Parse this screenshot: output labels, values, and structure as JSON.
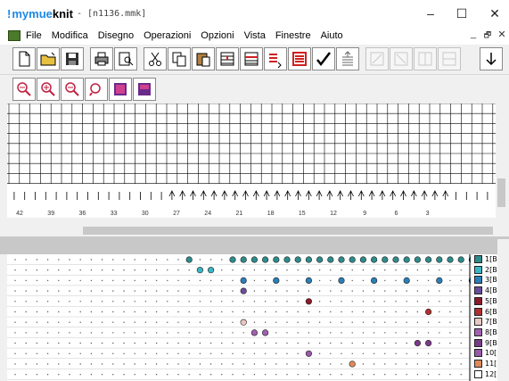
{
  "app": {
    "logo_bang": "!",
    "logo_brand": "mymue",
    "logo_bold": "knit",
    "file_title": "- [n1136.mmk]",
    "controls": {
      "minimize": "–",
      "maximize": "☐",
      "close": "✕"
    },
    "mdi_controls": {
      "minimize": "_",
      "restore": "🗗",
      "close": "✕"
    }
  },
  "menu": [
    {
      "key": "F",
      "rest": "ile"
    },
    {
      "key": "M",
      "rest": "odifica"
    },
    {
      "key": "D",
      "rest": "isegno"
    },
    {
      "key": "O",
      "rest": "perazioni"
    },
    {
      "key": "O",
      "rest": "pzioni",
      "pre": "",
      "raw": "Opzioni"
    },
    {
      "key": "V",
      "rest": "ista"
    },
    {
      "key": "F",
      "rest": "inestre"
    },
    {
      "key": "A",
      "rest": "iuto"
    }
  ],
  "menu_labels": [
    "File",
    "Modifica",
    "Disegno",
    "Operazioni",
    "Opzioni",
    "Vista",
    "Finestre",
    "Aiuto"
  ],
  "toolbar1": [
    "new-file-icon",
    "open-folder-icon",
    "save-disk-icon",
    "print-icon",
    "print-preview-icon",
    "cut-icon",
    "copy-icon",
    "paste-icon",
    "insert-rows-icon",
    "insert-cols-icon",
    "row-tool-icon",
    "row-color-icon",
    "check-icon",
    "stack-icon",
    "tool-a-icon",
    "tool-b-icon",
    "tool-c-icon",
    "tool-d-icon",
    "arrow-down-icon"
  ],
  "toolbar2": [
    "zoom-fit-icon",
    "zoom-in-icon",
    "zoom-out-icon",
    "zoom-reset-icon",
    "color-block-1-icon",
    "color-block-2-icon"
  ],
  "ruler_labels": [
    "42",
    "39",
    "36",
    "33",
    "30",
    "27",
    "24",
    "21",
    "18",
    "15",
    "12",
    "9",
    "6",
    "3"
  ],
  "swatches": [
    {
      "label": "1[B",
      "color": "#2e8b8b"
    },
    {
      "label": "2[B",
      "color": "#39b6c4"
    },
    {
      "label": "3[B",
      "color": "#2a7fb8"
    },
    {
      "label": "4[B",
      "color": "#6a4c9c"
    },
    {
      "label": "5[B",
      "color": "#8b1a2a"
    },
    {
      "label": "6[B",
      "color": "#b03030"
    },
    {
      "label": "7[B",
      "color": "#e8c8c0"
    },
    {
      "label": "8[B",
      "color": "#a060b0"
    },
    {
      "label": "9[B",
      "color": "#7a3a8a"
    },
    {
      "label": "10[",
      "color": "#9a58a8"
    },
    {
      "label": "11[",
      "color": "#e08a5a"
    },
    {
      "label": "12[",
      "color": "#ffffff"
    }
  ],
  "pattern_rows": [
    {
      "color": "#2e8b8b",
      "cols": [
        29,
        25,
        24,
        23,
        22,
        21,
        20,
        19,
        18,
        17,
        16,
        15,
        14,
        13,
        12,
        11,
        10,
        9,
        8,
        7,
        6,
        5,
        4,
        3
      ]
    },
    {
      "color": "#39b6c4",
      "cols": [
        28,
        27
      ]
    },
    {
      "color": "#2a7fb8",
      "cols": [
        24,
        21,
        18,
        15,
        12,
        9,
        6,
        3
      ]
    },
    {
      "color": "#6a4c9c",
      "cols": [
        24
      ]
    },
    {
      "color": "#8b1a2a",
      "cols": [
        18
      ]
    },
    {
      "color": "#b03030",
      "cols": [
        7
      ]
    },
    {
      "color": "#e8c8c0",
      "cols": [
        24
      ]
    },
    {
      "color": "#a060b0",
      "cols": [
        23,
        22
      ]
    },
    {
      "color": "#7a3a8a",
      "cols": [
        8,
        7
      ]
    },
    {
      "color": "#9a58a8",
      "cols": [
        18
      ]
    },
    {
      "color": "#e08a5a",
      "cols": [
        14
      ]
    },
    {
      "color": "#ffffff",
      "cols": []
    }
  ]
}
